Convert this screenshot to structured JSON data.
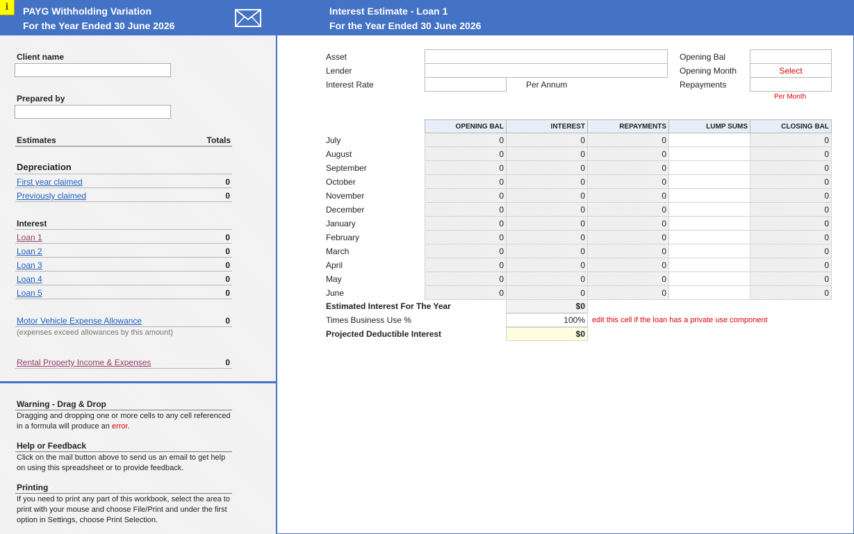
{
  "left_header": {
    "info_glyph": "i",
    "title": "PAYG Withholding Variation",
    "subtitle": "For the Year Ended 30 June 2026"
  },
  "client": {
    "label": "Client name",
    "value": ""
  },
  "prepared": {
    "label": "Prepared by",
    "value": ""
  },
  "estimates": {
    "label": "Estimates",
    "totals_label": "Totals"
  },
  "depreciation": {
    "heading": "Depreciation",
    "items": [
      {
        "label": "First year claimed",
        "value": "0"
      },
      {
        "label": "Previously claimed",
        "value": "0"
      }
    ]
  },
  "interest": {
    "heading": "Interest",
    "items": [
      {
        "label": "Loan 1",
        "value": "0"
      },
      {
        "label": "Loan 2",
        "value": "0"
      },
      {
        "label": "Loan 3",
        "value": "0"
      },
      {
        "label": "Loan 4",
        "value": "0"
      },
      {
        "label": "Loan 5",
        "value": "0"
      }
    ]
  },
  "motor": {
    "label": "Motor Vehicle Expense Allowance",
    "value": "0",
    "note": "(expenses exceed allowances by this amount)"
  },
  "rental": {
    "label": "Rental Property Income & Expenses",
    "value": "0"
  },
  "help": {
    "warning_title": "Warning - Drag & Drop",
    "warning_text": "Dragging and dropping one or more cells to any cell referenced in a formula will produce an",
    "warning_error": "error",
    "warning_end": ".",
    "feedback_title": "Help or Feedback",
    "feedback_text": "Click on the mail button above to send us an email to get help on using this spreadsheet or to provide feedback.",
    "printing_title": "Printing",
    "printing_text": "If you need to print any part of this workbook, select the area to print with your mouse and choose File/Print and under the first option in Settings, choose Print Selection."
  },
  "right_header": {
    "title": "Interest Estimate - Loan 1",
    "subtitle": "For the Year Ended 30 June 2026"
  },
  "loan_fields": {
    "asset_label": "Asset",
    "lender_label": "Lender",
    "rate_label": "Interest Rate",
    "per_annum": "Per Annum",
    "opening_bal_label": "Opening Bal",
    "opening_month_label": "Opening Month",
    "opening_month_value": "Select",
    "repayments_label": "Repayments",
    "per_month": "Per Month"
  },
  "table": {
    "headers": [
      "OPENING BAL",
      "INTEREST",
      "REPAYMENTS",
      "LUMP SUMS",
      "CLOSING BAL"
    ],
    "rows": [
      {
        "month": "July",
        "opening": "0",
        "interest": "0",
        "repayments": "0",
        "lump": "",
        "closing": "0"
      },
      {
        "month": "August",
        "opening": "0",
        "interest": "0",
        "repayments": "0",
        "lump": "",
        "closing": "0"
      },
      {
        "month": "September",
        "opening": "0",
        "interest": "0",
        "repayments": "0",
        "lump": "",
        "closing": "0"
      },
      {
        "month": "October",
        "opening": "0",
        "interest": "0",
        "repayments": "0",
        "lump": "",
        "closing": "0"
      },
      {
        "month": "November",
        "opening": "0",
        "interest": "0",
        "repayments": "0",
        "lump": "",
        "closing": "0"
      },
      {
        "month": "December",
        "opening": "0",
        "interest": "0",
        "repayments": "0",
        "lump": "",
        "closing": "0"
      },
      {
        "month": "January",
        "opening": "0",
        "interest": "0",
        "repayments": "0",
        "lump": "",
        "closing": "0"
      },
      {
        "month": "February",
        "opening": "0",
        "interest": "0",
        "repayments": "0",
        "lump": "",
        "closing": "0"
      },
      {
        "month": "March",
        "opening": "0",
        "interest": "0",
        "repayments": "0",
        "lump": "",
        "closing": "0"
      },
      {
        "month": "April",
        "opening": "0",
        "interest": "0",
        "repayments": "0",
        "lump": "",
        "closing": "0"
      },
      {
        "month": "May",
        "opening": "0",
        "interest": "0",
        "repayments": "0",
        "lump": "",
        "closing": "0"
      },
      {
        "month": "June",
        "opening": "0",
        "interest": "0",
        "repayments": "0",
        "lump": "",
        "closing": "0"
      }
    ]
  },
  "summary": {
    "estimated_label": "Estimated Interest For The Year",
    "estimated_value": "$0",
    "business_use_label": "Times Business Use %",
    "business_use_value": "100%",
    "business_use_note": "edit this cell if the loan has a private use component",
    "projected_label": "Projected Deductible Interest",
    "projected_value": "$0"
  },
  "colors": {
    "header_blue": "#4472c4",
    "link_blue": "#1f5fbf",
    "link_visited": "#953d64",
    "alert_red": "#e00000",
    "highlight_yellow": "#fffde0"
  }
}
